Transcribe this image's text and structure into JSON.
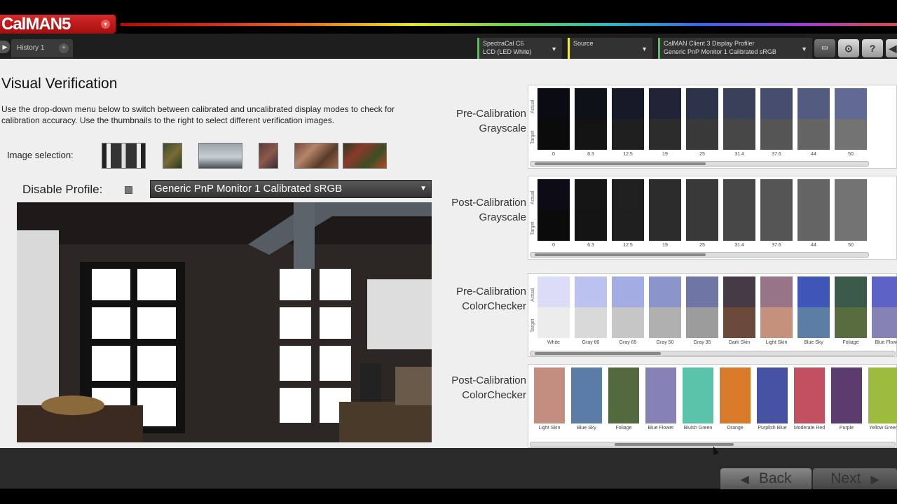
{
  "app": {
    "logo": "CalMAN5",
    "logo_dropdown": "▾"
  },
  "tabs": [
    {
      "label": "History 1",
      "add": "+"
    }
  ],
  "devices": [
    {
      "line1": "SpectraCal C6",
      "line2": "LCD (LED White)",
      "color": "#4c4"
    },
    {
      "line1": "Source",
      "line2": "",
      "color": "#ee4"
    },
    {
      "line1": "CalMAN Client 3 Display Profiler",
      "line2": "Generic PnP Monitor 1 Calibrated sRGB",
      "color": "#4c4"
    }
  ],
  "page": {
    "title": "Visual Verification",
    "description": "Use the drop-down menu below to switch between calibrated  and uncalibrated display modes to check for calibration accuracy. Use the thumbnails to the right to select different verification images.",
    "image_selection_label": "Image selection:",
    "disable_profile_label": "Disable Profile:",
    "profile_value": "Generic PnP Monitor 1 Calibrated sRGB"
  },
  "sections": {
    "pre_gray": "Pre-Calibration Grayscale",
    "post_gray": "Post-Calibration Grayscale",
    "pre_cc": "Pre-Calibration ColorChecker",
    "post_cc": "Post-Calibration ColorChecker",
    "actual": "Actual",
    "target": "Target"
  },
  "gray_labels": [
    "0",
    "6.3",
    "12.5",
    "19",
    "25",
    "31.4",
    "37.6",
    "44",
    "50"
  ],
  "pre_gray_actual": [
    "#0b0b14",
    "#0f1119",
    "#161a26",
    "#202436",
    "#2c3248",
    "#3a3f5a",
    "#474d6c",
    "#535b80",
    "#616a94"
  ],
  "gray_target": [
    "#0b0b0b",
    "#141414",
    "#1f1f1f",
    "#2c2c2c",
    "#393939",
    "#474747",
    "#555555",
    "#646464",
    "#737373"
  ],
  "post_gray_actual": [
    "#0d0c16",
    "#151515",
    "#202020",
    "#2c2c2c",
    "#393939",
    "#474747",
    "#555555",
    "#646464",
    "#737373"
  ],
  "pre_cc_labels": [
    "White",
    "Gray 80",
    "Gray 65",
    "Gray 50",
    "Gray 35",
    "Dark Skin",
    "Light Skin",
    "Blue Sky",
    "Foliage",
    "Blue Flower"
  ],
  "pre_cc_actual": [
    "#dcdcf8",
    "#bcc2f0",
    "#a4ace4",
    "#8c94cc",
    "#6e76a6",
    "#463a46",
    "#987488",
    "#3f55b7",
    "#3b5948",
    "#5d63c6"
  ],
  "pre_cc_target": [
    "#ececec",
    "#d9d9d9",
    "#c6c6c6",
    "#b0b0b0",
    "#9c9c9c",
    "#6b4a3c",
    "#c4917d",
    "#5c7ea4",
    "#596c40",
    "#8782b5"
  ],
  "post_cc_labels": [
    "Light Skin",
    "Blue Sky",
    "Foliage",
    "Blue Flower",
    "Bluish Green",
    "Orange",
    "Purplish Blue",
    "Moderate Red",
    "Purple",
    "Yellow Green"
  ],
  "post_cc_colors": [
    "#c38e80",
    "#5b7ca7",
    "#536a3f",
    "#8682b7",
    "#5bc3a9",
    "#d97a2b",
    "#4751a2",
    "#c35060",
    "#5c3b6e",
    "#9dbb3d"
  ],
  "buttons": {
    "back": "Back",
    "next": "Next"
  }
}
